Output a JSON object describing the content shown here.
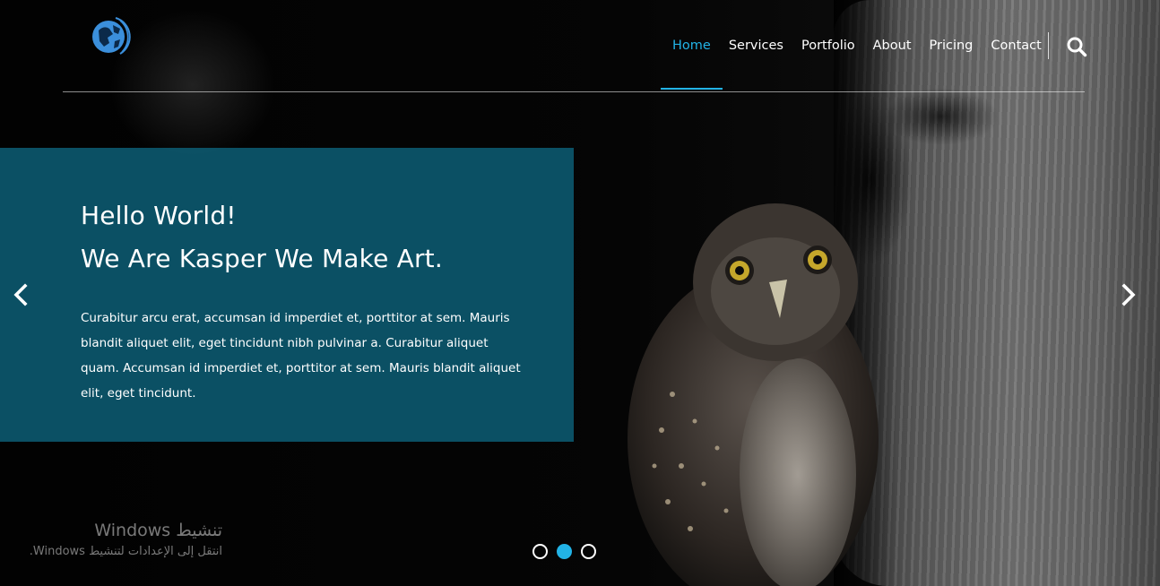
{
  "nav": {
    "logo_icon": "globe-logo-icon",
    "links": [
      {
        "label": "Home",
        "active": true
      },
      {
        "label": "Services",
        "active": false
      },
      {
        "label": "Portfolio",
        "active": false
      },
      {
        "label": "About",
        "active": false
      },
      {
        "label": "Pricing",
        "active": false
      },
      {
        "label": "Contact",
        "active": false
      }
    ],
    "search_icon": "search-icon",
    "accent_color": "#22b3e6"
  },
  "slider": {
    "heading_line1": "Hello World!",
    "heading_line2": "We Are Kasper We Make Art.",
    "body": "Curabitur arcu erat, accumsan id imperdiet et, porttitor at sem. Mauris blandit aliquet elit, eget tincidunt nibh pulvinar a. Curabitur aliquet quam. Accumsan id imperdiet et, porttitor at sem. Mauris blandit aliquet elit, eget tincidunt.",
    "prev_icon": "chevron-left-icon",
    "next_icon": "chevron-right-icon",
    "box_color": "#0e627a",
    "dots": [
      {
        "active": false
      },
      {
        "active": true
      },
      {
        "active": false
      }
    ]
  },
  "windows_watermark": {
    "title": "تنشيط Windows",
    "subtitle": "انتقل إلى الإعدادات لتنشيط Windows."
  }
}
